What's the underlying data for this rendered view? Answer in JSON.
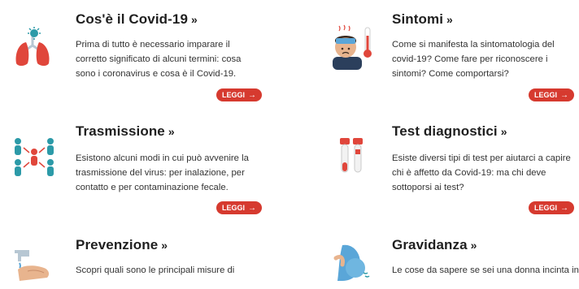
{
  "cards": [
    {
      "title": "Cos'è il Covid-19",
      "description": "Prima di tutto è necessario imparare il corretto significato di alcuni termini: cosa sono i coronavirus e cosa è il Covid-19.",
      "button": "LEGGI",
      "icon": "lungs-virus-icon"
    },
    {
      "title": "Sintomi",
      "description": "Come si manifesta la sintomatologia del covid-19? Come fare per riconoscere i sintomi? Come comportarsi?",
      "button": "LEGGI",
      "icon": "fever-thermometer-icon"
    },
    {
      "title": "Trasmissione",
      "description": "Esistono alcuni modi in cui può avvenire la trasmissione del virus: per inalazione, per contatto e per contaminazione fecale.",
      "button": "LEGGI",
      "icon": "people-transmission-icon"
    },
    {
      "title": "Test diagnostici",
      "description": "Esiste diversi tipi di test per aiutarci a capire chi è affetto da Covid-19: ma chi deve sottoporsi ai test?",
      "button": "LEGGI",
      "icon": "test-tubes-icon"
    },
    {
      "title": "Prevenzione",
      "description": "Scopri quali sono le principali misure di",
      "button": "",
      "icon": "hand-washing-icon"
    },
    {
      "title": "Gravidanza",
      "description": "Le cose da sapere se sei una donna incinta in",
      "button": "",
      "icon": "pregnant-woman-icon"
    }
  ],
  "title_suffix": "»",
  "button_arrow": "→"
}
